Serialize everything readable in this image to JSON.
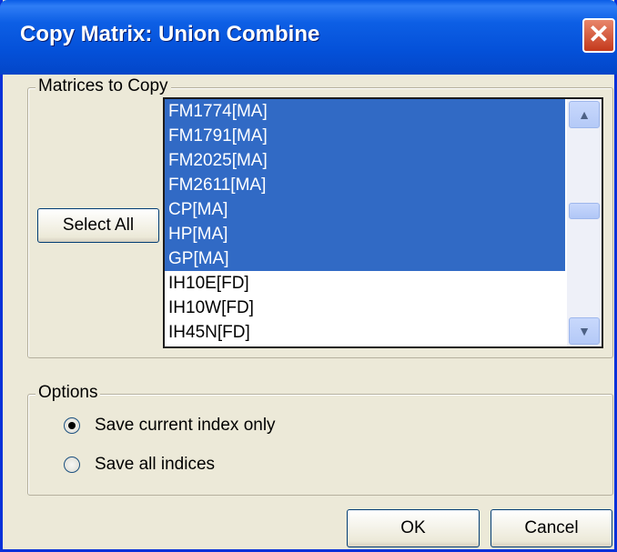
{
  "window": {
    "title": "Copy Matrix: Union Combine",
    "close_glyph": "✕"
  },
  "matrices": {
    "legend": "Matrices to Copy",
    "select_all_label": "Select All",
    "items": [
      {
        "label": "FM1774[MA]",
        "selected": true
      },
      {
        "label": "FM1791[MA]",
        "selected": true
      },
      {
        "label": "FM2025[MA]",
        "selected": true
      },
      {
        "label": "FM2611[MA]",
        "selected": true
      },
      {
        "label": "CP[MA]",
        "selected": true
      },
      {
        "label": "HP[MA]",
        "selected": true
      },
      {
        "label": "GP[MA]",
        "selected": true
      },
      {
        "label": "IH10E[FD]",
        "selected": false
      },
      {
        "label": "IH10W[FD]",
        "selected": false
      },
      {
        "label": "IH45N[FD]",
        "selected": false
      }
    ],
    "scroll_up_glyph": "▲",
    "scroll_down_glyph": "▼"
  },
  "options": {
    "legend": "Options",
    "radios": [
      {
        "label": "Save current index only",
        "checked": true
      },
      {
        "label": "Save all indices",
        "checked": false
      }
    ]
  },
  "buttons": {
    "ok": "OK",
    "cancel": "Cancel"
  },
  "colors": {
    "selection": "#316ac5",
    "titlebar": "#0450d8",
    "dialog_bg": "#ece9d8"
  }
}
